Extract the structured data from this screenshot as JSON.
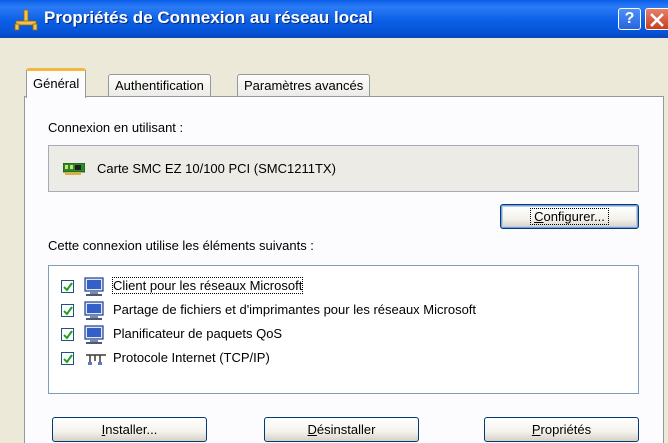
{
  "window": {
    "title": "Propriétés de Connexion au réseau local",
    "help_label": "?"
  },
  "tabs": [
    {
      "label": "Général",
      "active": true
    },
    {
      "label": "Authentification",
      "active": false
    },
    {
      "label": "Paramètres avancés",
      "active": false
    }
  ],
  "connection": {
    "label": "Connexion en utilisant :",
    "adapter": "Carte SMC EZ 10/100 PCI (SMC1211TX)",
    "configure_button": {
      "text": "Configurer...",
      "mnemonic": "C",
      "rest": "onfigurer..."
    }
  },
  "components": {
    "label": "Cette connexion utilise les éléments suivants :",
    "items": [
      {
        "label": "Client pour les réseaux Microsoft",
        "checked": true,
        "icon": "network-client-icon"
      },
      {
        "label": "Partage de fichiers et d'imprimantes pour les réseaux Microsoft",
        "checked": true,
        "icon": "network-service-icon"
      },
      {
        "label": "Planificateur de paquets QoS",
        "checked": true,
        "icon": "network-service-icon"
      },
      {
        "label": "Protocole Internet (TCP/IP)",
        "checked": true,
        "icon": "network-protocol-icon"
      }
    ]
  },
  "buttons": {
    "install": {
      "text": "Installer...",
      "mnemonic": "I",
      "rest": "nstaller..."
    },
    "uninstall": {
      "text": "Désinstaller",
      "mnemonic": "D",
      "rest": "ésinstaller"
    },
    "properties": {
      "text": "Propriétés",
      "mnemonic": "P",
      "rest": "ropriétés"
    }
  },
  "colors": {
    "titlebar": "#0a5ee8",
    "dialog_bg": "#ece9d8",
    "tab_highlight": "#f6b83c",
    "close_button": "#c5401f"
  }
}
